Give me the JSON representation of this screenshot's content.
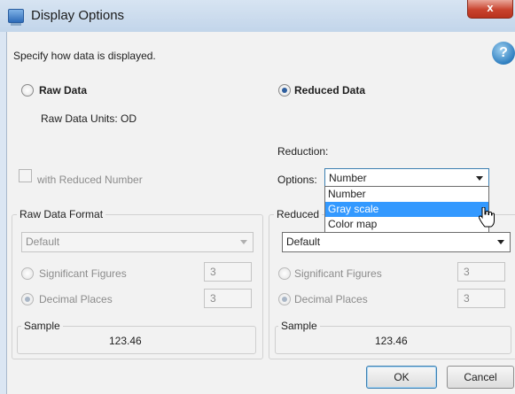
{
  "window": {
    "title": "Display Options",
    "close_label": "x"
  },
  "intro_text": "Specify how data is displayed.",
  "help_label": "?",
  "raw": {
    "radio_label": "Raw Data",
    "units_label": "Raw Data Units: OD",
    "checkbox_label": "with Reduced Number",
    "format_group_label": "Raw Data Format",
    "format_value": "Default",
    "sig_fig_label": "Significant Figures",
    "sig_fig_value": "3",
    "decimal_label": "Decimal Places",
    "decimal_value": "3",
    "sample_label": "Sample",
    "sample_value": "123.46"
  },
  "reduced": {
    "radio_label": "Reduced Data",
    "reduction_label": "Reduction:",
    "options_label": "Options:",
    "options_value": "Number",
    "dropdown_items": [
      "Number",
      "Gray scale",
      "Color map"
    ],
    "highlighted_item": "Gray scale",
    "format_group_label": "Reduced",
    "format_value": "Default",
    "sig_fig_label": "Significant Figures",
    "sig_fig_value": "3",
    "decimal_label": "Decimal Places",
    "decimal_value": "3",
    "sample_label": "Sample",
    "sample_value": "123.46"
  },
  "buttons": {
    "ok": "OK",
    "cancel": "Cancel"
  }
}
